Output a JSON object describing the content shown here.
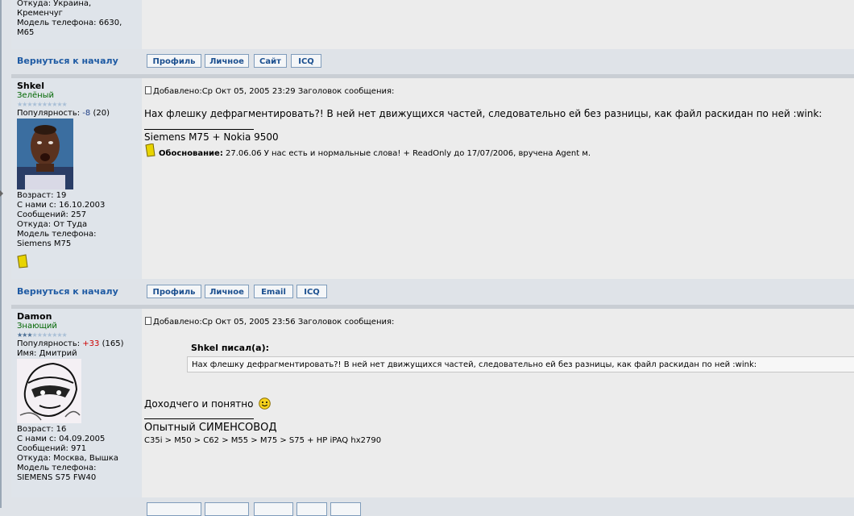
{
  "post0": {
    "from": "Откуда: Украина,",
    "from2": "Кременчуг",
    "phone": "Модель телефона: 6630,",
    "phone2": "M65",
    "back": "Вернуться к началу",
    "buttons": [
      "Профиль",
      "Личное",
      "Сайт",
      "ICQ"
    ]
  },
  "post1": {
    "username": "Shkel",
    "rank": "Зелёный",
    "stars_filled": 0,
    "popularity_label": "Популярность:",
    "popularity_value": "-8",
    "popularity_count": "(20)",
    "age": "Возраст: 19",
    "joined": "С нами с: 16.10.2003",
    "posts": "Сообщений: 257",
    "from": "Откуда: От Туда",
    "phone_label": "Модель телефона:",
    "phone_value": "Siemens M75",
    "header": "Добавлено:Ср Окт 05, 2005 23:29   Заголовок сообщения:",
    "body": "Нах флешку дефрагментировать?! В ней нет движущихся частей, следовательно ей без разницы, как файл раскидан по ней :wink:",
    "signature": "Siemens M75 + Nokia 9500",
    "moderation_label": "Обоснование:",
    "moderation_text": "27.06.06 У нас есть и нормальные слова! + ReadOnly до 17/07/2006, вручена Agent м.",
    "back": "Вернуться к началу",
    "buttons": [
      "Профиль",
      "Личное",
      "Email",
      "ICQ"
    ]
  },
  "post2": {
    "username": "Damon",
    "rank": "Знающий",
    "stars_filled": 3,
    "popularity_label": "Популярность:",
    "popularity_value": "+33",
    "popularity_count": "(165)",
    "name": "Имя: Дмитрий",
    "age": "Возраст: 16",
    "joined": "С нами с: 04.09.2005",
    "posts": "Сообщений: 971",
    "from": "Откуда: Москва, Вышка",
    "phone_label": "Модель телефона:",
    "phone_value": "SIEMENS S75 FW40",
    "header": "Добавлено:Ср Окт 05, 2005 23:56   Заголовок сообщения:",
    "quote_author": "Shkel писал(а):",
    "quote_text": "Нах флешку дефрагментировать?! В ней нет движущихся частей, следовательно ей без разницы, как файл раскидан по ней :wink:",
    "body": "Доходчего и понятно",
    "signature_title": "Опытный СИМЕНСОВОД",
    "signature_line": "C35i > M50 > C62 > M55 > M75 > S75 + HP iPAQ hx2790"
  },
  "icons": {
    "post_icon": "doc-icon",
    "warning": "yellow-card-icon",
    "smiley": "smile-icon"
  },
  "colors": {
    "link": "#1e5aa3",
    "negative": "#1f3f86",
    "positive": "#cc0000"
  }
}
